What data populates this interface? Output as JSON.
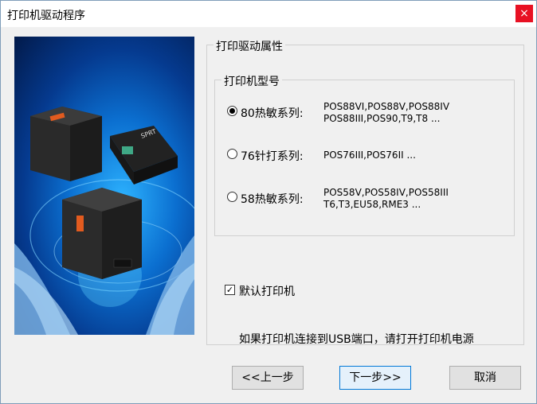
{
  "window": {
    "title": "打印机驱动程序",
    "close_glyph": "×"
  },
  "properties": {
    "group_title": "打印驱动属性",
    "model_group_title": "打印机型号",
    "options": [
      {
        "label": "80热敏系列:",
        "models_line1": "POS88VI,POS88V,POS88IV",
        "models_line2": "POS88III,POS90,T9,T8 ...",
        "selected": true
      },
      {
        "label": "76针打系列:",
        "models_line1": "POS76III,POS76II ...",
        "models_line2": "",
        "selected": false
      },
      {
        "label": "58热敏系列:",
        "models_line1": "POS58V,POS58IV,POS58III",
        "models_line2": "T6,T3,EU58,RME3 ...",
        "selected": false
      }
    ],
    "default_printer_label": "默认打印机",
    "default_printer_checked": true,
    "info_text": "如果打印机连接到USB端口，请打开打印机电源"
  },
  "image": {
    "brand_label": "SPRT"
  },
  "buttons": {
    "back": "<<上一步",
    "next": "下一步>>",
    "cancel": "取消"
  }
}
